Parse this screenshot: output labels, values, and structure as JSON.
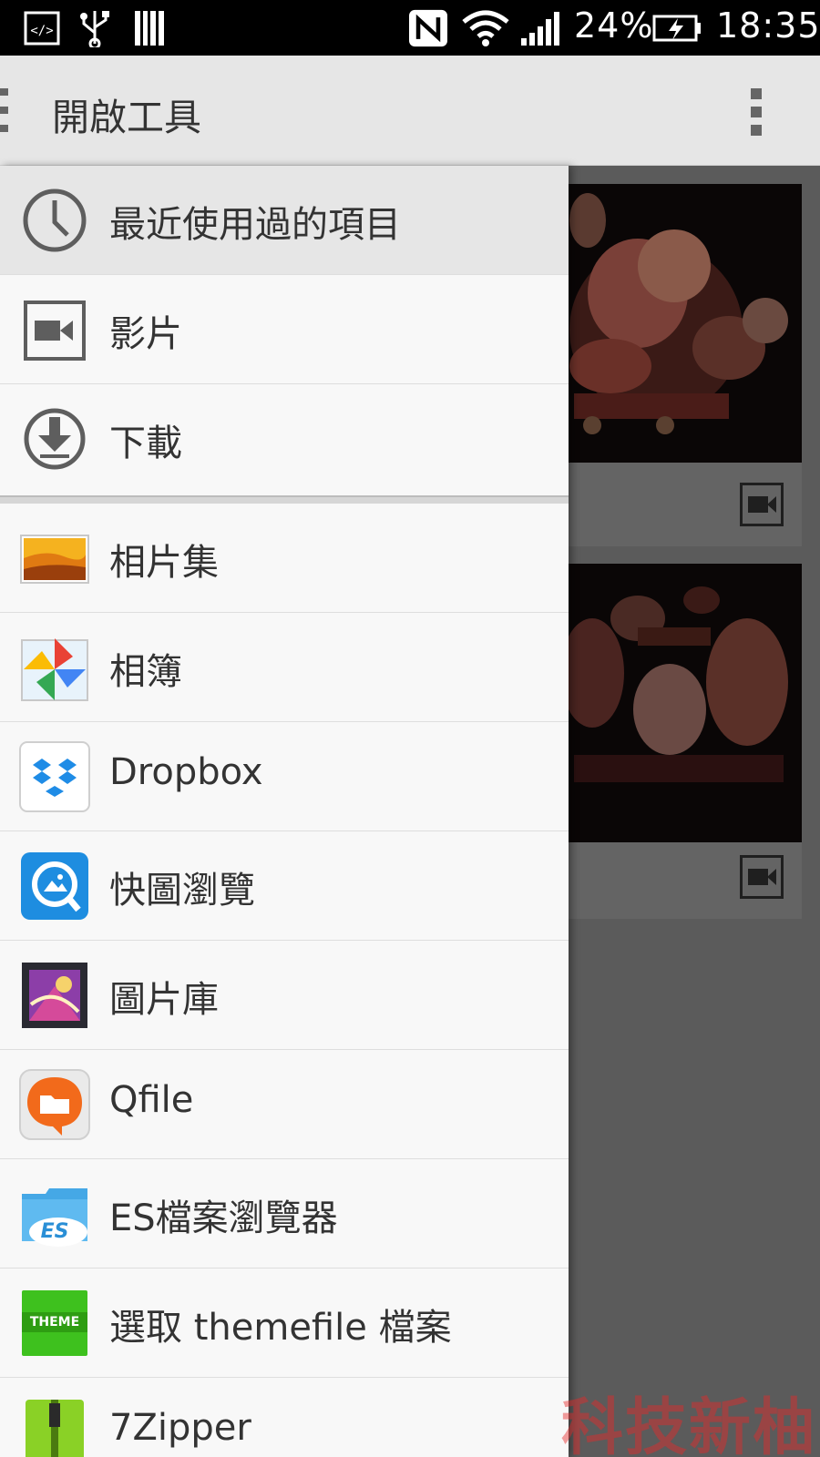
{
  "status_bar": {
    "battery": "24%",
    "time": "18:35",
    "icons": [
      "dev-mode-icon",
      "usb-icon",
      "barcode-icon",
      "nfc-icon",
      "wifi-icon",
      "signal-icon",
      "battery-charging-icon"
    ]
  },
  "action_bar": {
    "title": "開啟工具",
    "overflow_icon": "overflow-menu-icon"
  },
  "drawer": {
    "places": [
      {
        "label": "最近使用過的項目",
        "icon": "clock-icon",
        "selected": true
      },
      {
        "label": "影片",
        "icon": "video-icon"
      },
      {
        "label": "下載",
        "icon": "download-icon"
      }
    ],
    "apps": [
      {
        "label": "相片集",
        "icon": "gallery-landscape-icon"
      },
      {
        "label": "相簿",
        "icon": "photos-pinwheel-icon"
      },
      {
        "label": "Dropbox",
        "icon": "dropbox-icon"
      },
      {
        "label": "快圖瀏覽",
        "icon": "quickpic-icon"
      },
      {
        "label": "圖片庫",
        "icon": "picture-library-icon"
      },
      {
        "label": "Qfile",
        "icon": "qfile-icon"
      },
      {
        "label": "ES檔案瀏覽器",
        "icon": "es-file-explorer-icon"
      },
      {
        "label": "選取 themefile 檔案",
        "icon": "theme-icon",
        "icon_text": "THEME"
      },
      {
        "label": "7Zipper",
        "icon": "zipper-icon"
      }
    ]
  },
  "background_cards": [
    {
      "type": "video",
      "icon": "video-icon"
    },
    {
      "type": "video",
      "icon": "video-icon"
    }
  ],
  "watermark": "科技新柚"
}
